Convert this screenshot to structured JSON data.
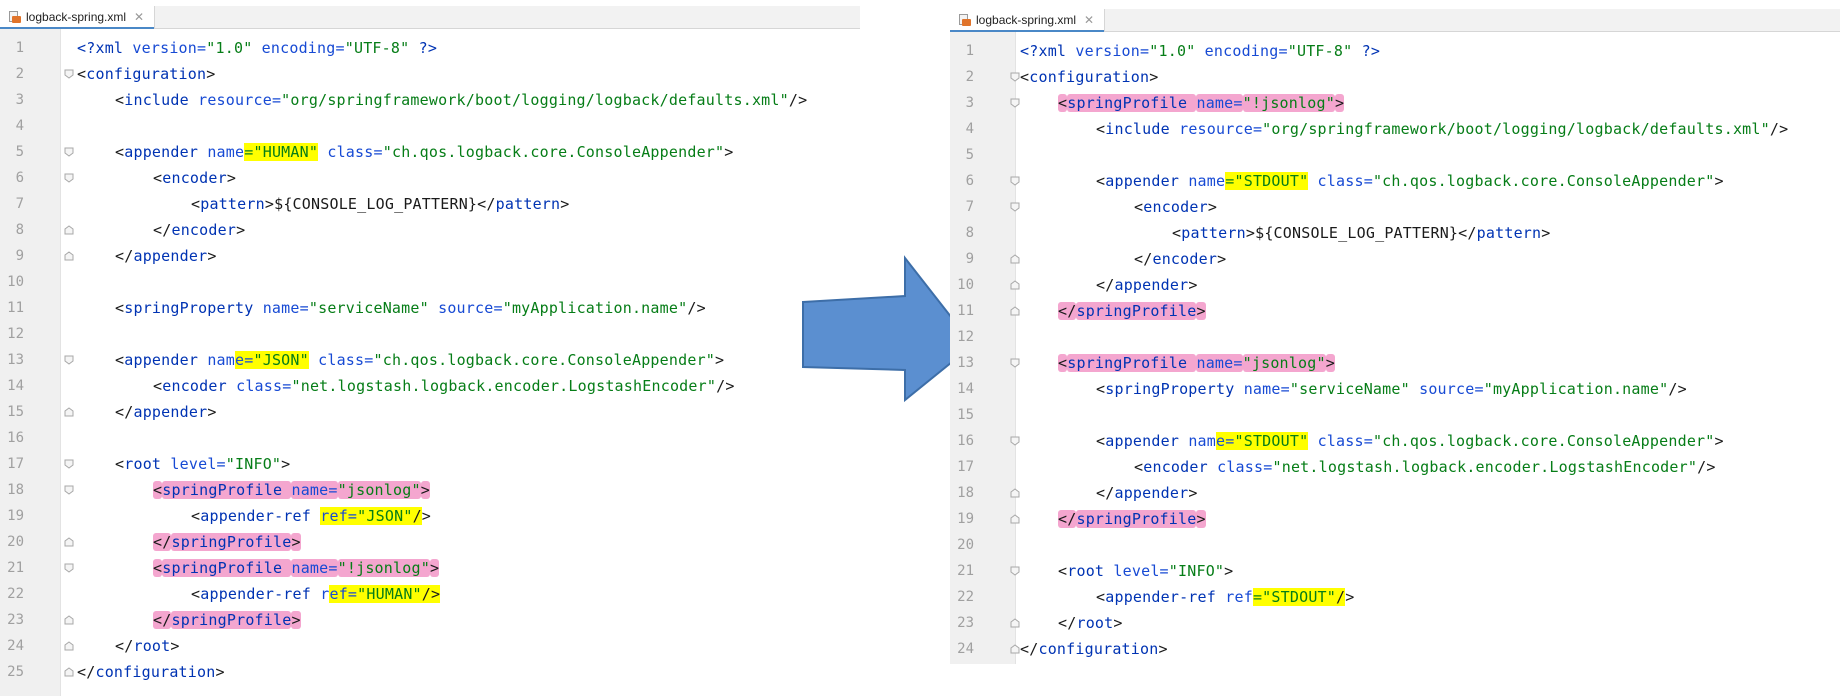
{
  "left_panel": {
    "tab_title": "logback-spring.xml",
    "lines": [
      {
        "n": "1",
        "indent": 0,
        "fold": "",
        "segs": [
          [
            "pi",
            "<?"
          ],
          [
            "tag",
            "xml "
          ],
          [
            "attr",
            "version="
          ],
          [
            "val",
            "\"1.0\""
          ],
          [
            "attr",
            " encoding="
          ],
          [
            "val",
            "\"UTF-8\""
          ],
          [
            "pi",
            " ?>"
          ]
        ]
      },
      {
        "n": "2",
        "indent": 0,
        "fold": "open",
        "segs": [
          [
            "p",
            "<"
          ],
          [
            "tag",
            "configuration"
          ],
          [
            "p",
            ">"
          ]
        ]
      },
      {
        "n": "3",
        "indent": 1,
        "fold": "",
        "segs": [
          [
            "p",
            "<"
          ],
          [
            "tag",
            "include "
          ],
          [
            "attr",
            "resource="
          ],
          [
            "val",
            "\"org/springframework/boot/logging/logback/defaults.xml\""
          ],
          [
            "p",
            "/>"
          ]
        ]
      },
      {
        "n": "4",
        "indent": 0,
        "fold": "",
        "segs": []
      },
      {
        "n": "5",
        "indent": 1,
        "fold": "open",
        "segs": [
          [
            "p",
            "<"
          ],
          [
            "tag",
            "appender "
          ],
          [
            "attr",
            "name"
          ],
          [
            "val",
            "=\"HUMAN\"",
            "y"
          ],
          [
            "attr",
            " class="
          ],
          [
            "val",
            "\"ch.qos.logback.core.ConsoleAppender\""
          ],
          [
            "p",
            ">"
          ]
        ]
      },
      {
        "n": "6",
        "indent": 2,
        "fold": "open",
        "segs": [
          [
            "p",
            "<"
          ],
          [
            "tag",
            "encoder"
          ],
          [
            "p",
            ">"
          ]
        ]
      },
      {
        "n": "7",
        "indent": 3,
        "fold": "",
        "segs": [
          [
            "p",
            "<"
          ],
          [
            "tag",
            "pattern"
          ],
          [
            "p",
            ">${CONSOLE_LOG_PATTERN}</"
          ],
          [
            "tag",
            "pattern"
          ],
          [
            "p",
            ">"
          ]
        ]
      },
      {
        "n": "8",
        "indent": 2,
        "fold": "close",
        "segs": [
          [
            "p",
            "</"
          ],
          [
            "tag",
            "encoder"
          ],
          [
            "p",
            ">"
          ]
        ]
      },
      {
        "n": "9",
        "indent": 1,
        "fold": "close",
        "segs": [
          [
            "p",
            "</"
          ],
          [
            "tag",
            "appender"
          ],
          [
            "p",
            ">"
          ]
        ]
      },
      {
        "n": "10",
        "indent": 0,
        "fold": "",
        "segs": []
      },
      {
        "n": "11",
        "indent": 1,
        "fold": "",
        "segs": [
          [
            "p",
            "<"
          ],
          [
            "tag",
            "springProperty "
          ],
          [
            "attr",
            "name="
          ],
          [
            "val",
            "\"serviceName\""
          ],
          [
            "attr",
            " source="
          ],
          [
            "val",
            "\"myApplication.name\""
          ],
          [
            "p",
            "/>"
          ]
        ]
      },
      {
        "n": "12",
        "indent": 0,
        "fold": "",
        "segs": []
      },
      {
        "n": "13",
        "indent": 1,
        "fold": "open",
        "segs": [
          [
            "p",
            "<"
          ],
          [
            "tag",
            "appender "
          ],
          [
            "attr",
            "nam"
          ],
          [
            "attr",
            "e=",
            "y"
          ],
          [
            "val",
            "\"JSON\"",
            "y"
          ],
          [
            "attr",
            " class="
          ],
          [
            "val",
            "\"ch.qos.logback.core.ConsoleAppender\""
          ],
          [
            "p",
            ">"
          ]
        ]
      },
      {
        "n": "14",
        "indent": 2,
        "fold": "",
        "segs": [
          [
            "p",
            "<"
          ],
          [
            "tag",
            "encoder "
          ],
          [
            "attr",
            "class="
          ],
          [
            "val",
            "\"net.logstash.logback.encoder.LogstashEncoder\""
          ],
          [
            "p",
            "/>"
          ]
        ]
      },
      {
        "n": "15",
        "indent": 1,
        "fold": "close",
        "segs": [
          [
            "p",
            "</"
          ],
          [
            "tag",
            "appender"
          ],
          [
            "p",
            ">"
          ]
        ]
      },
      {
        "n": "16",
        "indent": 0,
        "fold": "",
        "segs": []
      },
      {
        "n": "17",
        "indent": 1,
        "fold": "open",
        "segs": [
          [
            "p",
            "<"
          ],
          [
            "tag",
            "root "
          ],
          [
            "attr",
            "level="
          ],
          [
            "val",
            "\"INFO\""
          ],
          [
            "p",
            ">"
          ]
        ]
      },
      {
        "n": "18",
        "indent": 2,
        "fold": "open",
        "segs": [
          [
            "p",
            "<",
            "p"
          ],
          [
            "tag",
            "springProfile ",
            "p"
          ],
          [
            "attr",
            "name=",
            "p"
          ],
          [
            "val",
            "\"jsonlog\"",
            "p"
          ],
          [
            "p",
            ">",
            "p"
          ]
        ]
      },
      {
        "n": "19",
        "indent": 3,
        "fold": "",
        "segs": [
          [
            "p",
            "<"
          ],
          [
            "tag",
            "appender-ref "
          ],
          [
            "attr",
            "ref=",
            "y"
          ],
          [
            "val",
            "\"JSON\"",
            "y"
          ],
          [
            "p",
            "/",
            "y"
          ],
          [
            "p",
            ">"
          ]
        ]
      },
      {
        "n": "20",
        "indent": 2,
        "fold": "close",
        "segs": [
          [
            "p",
            "</",
            "p"
          ],
          [
            "tag",
            "springProfile",
            "p"
          ],
          [
            "p",
            ">",
            "p"
          ]
        ]
      },
      {
        "n": "21",
        "indent": 2,
        "fold": "open",
        "segs": [
          [
            "p",
            "<",
            "p"
          ],
          [
            "tag",
            "springProfile ",
            "p"
          ],
          [
            "attr",
            "name=",
            "p"
          ],
          [
            "val",
            "\"!jsonlog\"",
            "p"
          ],
          [
            "p",
            ">",
            "p"
          ]
        ]
      },
      {
        "n": "22",
        "indent": 3,
        "fold": "",
        "segs": [
          [
            "p",
            "<"
          ],
          [
            "tag",
            "appender-ref "
          ],
          [
            "attr",
            "r"
          ],
          [
            "attr",
            "ef=",
            "y"
          ],
          [
            "val",
            "\"HUMAN\"",
            "y"
          ],
          [
            "p",
            "/>",
            "y"
          ]
        ]
      },
      {
        "n": "23",
        "indent": 2,
        "fold": "close",
        "segs": [
          [
            "p",
            "</",
            "p"
          ],
          [
            "tag",
            "springProfile",
            "p"
          ],
          [
            "p",
            ">",
            "p"
          ]
        ]
      },
      {
        "n": "24",
        "indent": 1,
        "fold": "close",
        "segs": [
          [
            "p",
            "</"
          ],
          [
            "tag",
            "root"
          ],
          [
            "p",
            ">"
          ]
        ]
      },
      {
        "n": "25",
        "indent": 0,
        "fold": "close",
        "segs": [
          [
            "p",
            "</"
          ],
          [
            "tag",
            "configuration"
          ],
          [
            "p",
            ">"
          ]
        ]
      }
    ]
  },
  "right_panel": {
    "tab_title": "logback-spring.xml",
    "lines": [
      {
        "n": "1",
        "indent": 0,
        "fold": "",
        "segs": [
          [
            "pi",
            "<?"
          ],
          [
            "tag",
            "xml "
          ],
          [
            "attr",
            "version="
          ],
          [
            "val",
            "\"1.0\""
          ],
          [
            "attr",
            " encoding="
          ],
          [
            "val",
            "\"UTF-8\""
          ],
          [
            "pi",
            " ?>"
          ]
        ]
      },
      {
        "n": "2",
        "indent": 0,
        "fold": "open",
        "segs": [
          [
            "p",
            "<"
          ],
          [
            "tag",
            "configuration"
          ],
          [
            "p",
            ">"
          ]
        ]
      },
      {
        "n": "3",
        "indent": 1,
        "fold": "open",
        "segs": [
          [
            "p",
            "<",
            "p"
          ],
          [
            "tag",
            "springProfile ",
            "p"
          ],
          [
            "attr",
            "name=",
            "p"
          ],
          [
            "val",
            "\"!jsonlog\"",
            "p"
          ],
          [
            "p",
            ">",
            "p"
          ]
        ]
      },
      {
        "n": "4",
        "indent": 2,
        "fold": "",
        "segs": [
          [
            "p",
            "<"
          ],
          [
            "tag",
            "include "
          ],
          [
            "attr",
            "resource="
          ],
          [
            "val",
            "\"org/springframework/boot/logging/logback/defaults.xml\""
          ],
          [
            "p",
            "/>"
          ]
        ]
      },
      {
        "n": "5",
        "indent": 0,
        "fold": "",
        "segs": []
      },
      {
        "n": "6",
        "indent": 2,
        "fold": "open",
        "segs": [
          [
            "p",
            "<"
          ],
          [
            "tag",
            "appender "
          ],
          [
            "attr",
            "name"
          ],
          [
            "val",
            "=\"STDOUT\"",
            "y"
          ],
          [
            "attr",
            " class="
          ],
          [
            "val",
            "\"ch.qos.logback.core.ConsoleAppender\""
          ],
          [
            "p",
            ">"
          ]
        ]
      },
      {
        "n": "7",
        "indent": 3,
        "fold": "open",
        "segs": [
          [
            "p",
            "<"
          ],
          [
            "tag",
            "encoder"
          ],
          [
            "p",
            ">"
          ]
        ]
      },
      {
        "n": "8",
        "indent": 4,
        "fold": "",
        "segs": [
          [
            "p",
            "<"
          ],
          [
            "tag",
            "pattern"
          ],
          [
            "p",
            ">${CONSOLE_LOG_PATTERN}</"
          ],
          [
            "tag",
            "pattern"
          ],
          [
            "p",
            ">"
          ]
        ]
      },
      {
        "n": "9",
        "indent": 3,
        "fold": "close",
        "segs": [
          [
            "p",
            "</"
          ],
          [
            "tag",
            "encoder"
          ],
          [
            "p",
            ">"
          ]
        ]
      },
      {
        "n": "10",
        "indent": 2,
        "fold": "close",
        "segs": [
          [
            "p",
            "</"
          ],
          [
            "tag",
            "appender"
          ],
          [
            "p",
            ">"
          ]
        ]
      },
      {
        "n": "11",
        "indent": 1,
        "fold": "close",
        "segs": [
          [
            "p",
            "</",
            "p"
          ],
          [
            "tag",
            "springProfile",
            "p"
          ],
          [
            "p",
            ">",
            "p"
          ]
        ]
      },
      {
        "n": "12",
        "indent": 0,
        "fold": "",
        "segs": []
      },
      {
        "n": "13",
        "indent": 1,
        "fold": "open",
        "segs": [
          [
            "p",
            "<",
            "p"
          ],
          [
            "tag",
            "springProfile ",
            "p"
          ],
          [
            "attr",
            "name=",
            "p"
          ],
          [
            "val",
            "\"jsonlog\"",
            "p"
          ],
          [
            "p",
            ">",
            "p"
          ]
        ]
      },
      {
        "n": "14",
        "indent": 2,
        "fold": "",
        "segs": [
          [
            "p",
            "<"
          ],
          [
            "tag",
            "springProperty "
          ],
          [
            "attr",
            "name="
          ],
          [
            "val",
            "\"serviceName\""
          ],
          [
            "attr",
            " source="
          ],
          [
            "val",
            "\"myApplication.name\""
          ],
          [
            "p",
            "/>"
          ]
        ]
      },
      {
        "n": "15",
        "indent": 0,
        "fold": "",
        "segs": []
      },
      {
        "n": "16",
        "indent": 2,
        "fold": "open",
        "segs": [
          [
            "p",
            "<"
          ],
          [
            "tag",
            "appender "
          ],
          [
            "attr",
            "nam"
          ],
          [
            "attr",
            "e=",
            "y"
          ],
          [
            "val",
            "\"STDOUT\"",
            "y"
          ],
          [
            "attr",
            " class="
          ],
          [
            "val",
            "\"ch.qos.logback.core.ConsoleAppender\""
          ],
          [
            "p",
            ">"
          ]
        ]
      },
      {
        "n": "17",
        "indent": 3,
        "fold": "",
        "segs": [
          [
            "p",
            "<"
          ],
          [
            "tag",
            "encoder "
          ],
          [
            "attr",
            "class="
          ],
          [
            "val",
            "\"net.logstash.logback.encoder.LogstashEncoder\""
          ],
          [
            "p",
            "/>"
          ]
        ]
      },
      {
        "n": "18",
        "indent": 2,
        "fold": "close",
        "segs": [
          [
            "p",
            "</"
          ],
          [
            "tag",
            "appender"
          ],
          [
            "p",
            ">"
          ]
        ]
      },
      {
        "n": "19",
        "indent": 1,
        "fold": "close",
        "segs": [
          [
            "p",
            "</",
            "p"
          ],
          [
            "tag",
            "springProfile",
            "p"
          ],
          [
            "p",
            ">",
            "p"
          ]
        ]
      },
      {
        "n": "20",
        "indent": 0,
        "fold": "",
        "segs": []
      },
      {
        "n": "21",
        "indent": 1,
        "fold": "open",
        "segs": [
          [
            "p",
            "<"
          ],
          [
            "tag",
            "root "
          ],
          [
            "attr",
            "level="
          ],
          [
            "val",
            "\"INFO\""
          ],
          [
            "p",
            ">"
          ]
        ]
      },
      {
        "n": "22",
        "indent": 2,
        "fold": "",
        "segs": [
          [
            "p",
            "<"
          ],
          [
            "tag",
            "appender-ref "
          ],
          [
            "attr",
            "ref"
          ],
          [
            "val",
            "=\"STDOUT\"",
            "y"
          ],
          [
            "p",
            "/",
            "y"
          ],
          [
            "p",
            ">"
          ]
        ]
      },
      {
        "n": "23",
        "indent": 1,
        "fold": "close",
        "segs": [
          [
            "p",
            "</"
          ],
          [
            "tag",
            "root"
          ],
          [
            "p",
            ">"
          ]
        ]
      },
      {
        "n": "24",
        "indent": 0,
        "fold": "close",
        "segs": [
          [
            "p",
            "</"
          ],
          [
            "tag",
            "configuration"
          ],
          [
            "p",
            ">"
          ]
        ]
      }
    ]
  },
  "arrow": {
    "fill": "#5b8fd0",
    "stroke": "#3d6ea8",
    "icon": "right-arrow-icon"
  },
  "colors": {
    "yellow_highlight": "#ffff00",
    "pink_highlight": "#f4a6cf",
    "tag": "#0033b3",
    "value": "#067d17"
  }
}
